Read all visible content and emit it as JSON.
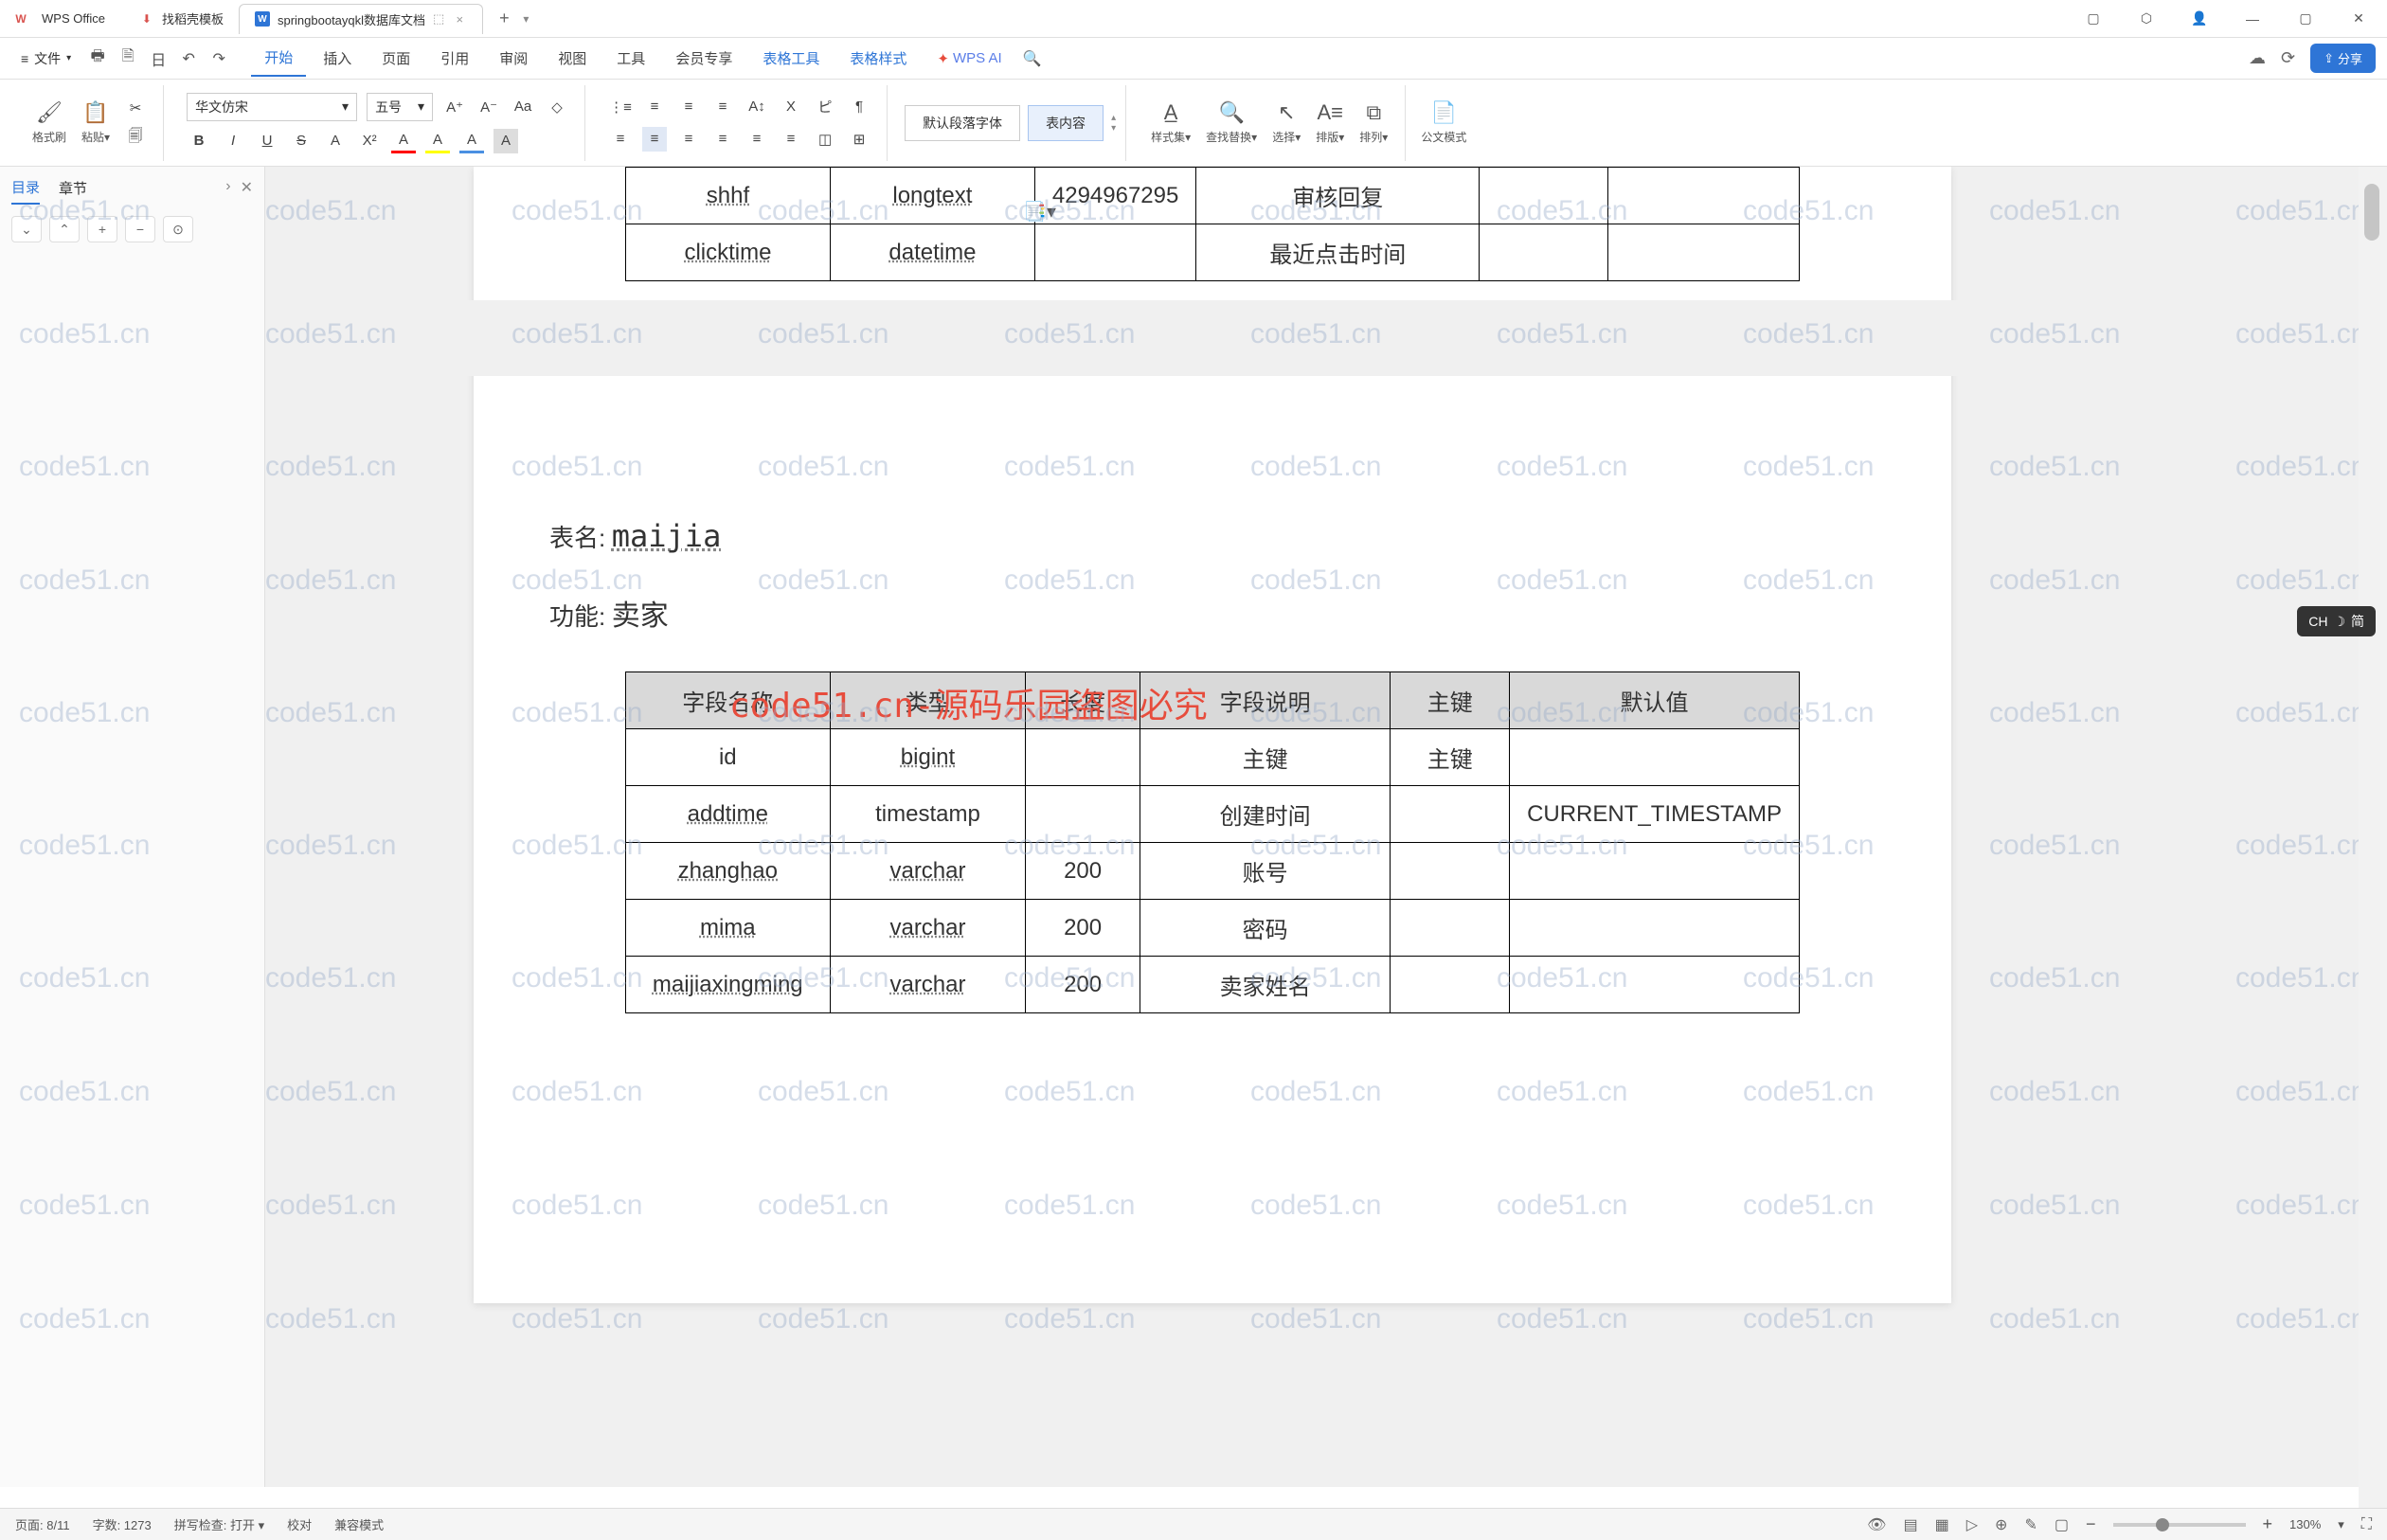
{
  "app": {
    "name": "WPS Office"
  },
  "tabs": [
    {
      "icon": "⬇",
      "icon_color": "#d9534f",
      "label": "找稻壳模板"
    },
    {
      "icon": "W",
      "icon_color": "#2e75d6",
      "label": "springbootayqkl数据库文档",
      "modified": "⬚",
      "active": true
    }
  ],
  "tab_close": "×",
  "tab_add": "+",
  "tab_dropdown": "▾",
  "win_icons": [
    "▢",
    "⬡",
    "👤",
    "—",
    "▢",
    "✕"
  ],
  "file_menu": {
    "icon": "≡",
    "label": "文件",
    "dd": "▾"
  },
  "quick_icons": [
    "🖶",
    "🗎",
    "日",
    "↶",
    "↷"
  ],
  "menu_tabs": [
    "开始",
    "插入",
    "页面",
    "引用",
    "审阅",
    "视图",
    "工具",
    "会员专享",
    "表格工具",
    "表格样式"
  ],
  "menu_active": "开始",
  "menu_blue": [
    "表格工具",
    "表格样式"
  ],
  "wps_ai": "WPS AI",
  "search_icon": "🔍",
  "cloud_icon": "☁",
  "history_icon": "⟳",
  "share": "分享",
  "ribbon": {
    "format_painter": "格式刷",
    "paste": "粘贴",
    "cut": "✂",
    "copy": "🗐",
    "font_name": "华文仿宋",
    "font_size": "五号",
    "bold": "B",
    "italic": "I",
    "underline": "U",
    "strike": "S",
    "super": "A",
    "sub": "X²",
    "aplus": "A⁺",
    "aminus": "A⁻",
    "case": "Aa",
    "clear": "◇",
    "font_color": "A",
    "highlight": "A",
    "border": "A",
    "list1": "⋮≡",
    "list2": "≡",
    "indent1": "≡",
    "indent2": "≡",
    "align_l": "≡",
    "align_c": "≡",
    "align_r": "≡",
    "align_j": "≡",
    "text_dir": "A↕",
    "char": "X",
    "ruby": "ピ",
    "para": "¶",
    "line_space": "≡",
    "shading": "◫",
    "para_style1": "默认段落字体",
    "para_style2": "表内容",
    "style_set": "样式集",
    "find_replace": "查找替换",
    "select": "选择",
    "rows": "排版",
    "sort": "排列",
    "official": "公文模式"
  },
  "nav": {
    "tab1": "目录",
    "tab2": "章节",
    "arrow": "›",
    "close": "✕",
    "tools": [
      "⌄",
      "⌃",
      "+",
      "−",
      "⊙"
    ]
  },
  "doc": {
    "combo_icon": "📑▾",
    "table1": {
      "rows": [
        {
          "name": "shhf",
          "type": "longtext",
          "len": "4294967295",
          "desc": "审核回复",
          "pk": "",
          "def": ""
        },
        {
          "name": "clicktime",
          "type": "datetime",
          "len": "",
          "desc": "最近点击时间",
          "pk": "",
          "def": ""
        }
      ]
    },
    "table_label": "表名:",
    "table_name": "maijia",
    "func_label": "功能:",
    "func_value": "卖家",
    "watermark_red": "code51.cn-源码乐园盗图必究",
    "table2": {
      "headers": [
        "字段名称",
        "类型",
        "长度",
        "字段说明",
        "主键",
        "默认值"
      ],
      "rows": [
        {
          "name": "id",
          "type": "bigint",
          "len": "",
          "desc": "主键",
          "pk": "主键",
          "def": ""
        },
        {
          "name": "addtime",
          "type": "timestamp",
          "len": "",
          "desc": "创建时间",
          "pk": "",
          "def": "CURRENT_TIMESTAMP"
        },
        {
          "name": "zhanghao",
          "type": "varchar",
          "len": "200",
          "desc": "账号",
          "pk": "",
          "def": ""
        },
        {
          "name": "mima",
          "type": "varchar",
          "len": "200",
          "desc": "密码",
          "pk": "",
          "def": ""
        },
        {
          "name": "maijiaxingming",
          "type": "varchar",
          "len": "200",
          "desc": "卖家姓名",
          "pk": "",
          "def": ""
        }
      ]
    }
  },
  "watermark_text": "code51.cn",
  "ime": {
    "lang": "CH",
    "icon": "☽",
    "mode": "简"
  },
  "status": {
    "page": "页面: 8/11",
    "words": "字数: 1273",
    "spell": "拼写检查: 打开",
    "spell_dd": "▾",
    "review": "校对",
    "compat": "兼容模式",
    "icons": [
      "👁",
      "▤",
      "▦",
      "▷",
      "⊕",
      "✎",
      "▢"
    ],
    "zoom": "130%",
    "zoom_out": "−",
    "zoom_in": "+",
    "fit": "⛶"
  }
}
